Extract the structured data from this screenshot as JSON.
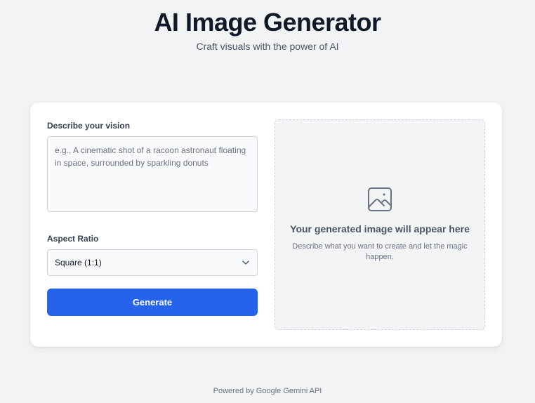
{
  "header": {
    "title": "AI Image Generator",
    "subtitle": "Craft visuals with the power of AI"
  },
  "form": {
    "prompt_label": "Describe your vision",
    "prompt_placeholder": "e.g., A cinematic shot of a racoon astronaut floating in space, surrounded by sparkling donuts",
    "prompt_value": "",
    "aspect_label": "Aspect Ratio",
    "aspect_selected": "Square (1:1)",
    "generate_label": "Generate"
  },
  "preview": {
    "icon": "image-icon",
    "title": "Your generated image will appear here",
    "description": "Describe what you want to create and let the magic happen."
  },
  "footer": {
    "text": "Powered by Google Gemini API"
  },
  "colors": {
    "accent": "#2563eb",
    "background": "#f2f3f5"
  }
}
